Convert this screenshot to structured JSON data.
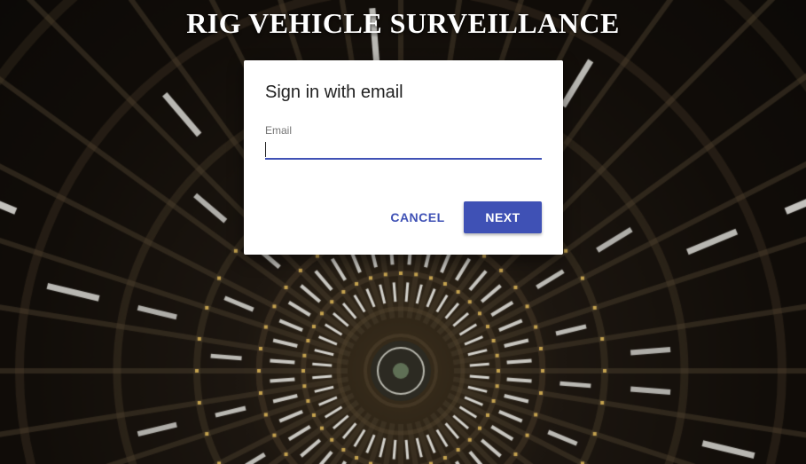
{
  "app": {
    "title": "RIG VEHICLE SURVEILLANCE"
  },
  "dialog": {
    "title": "Sign in with email",
    "email_label": "Email",
    "email_value": "",
    "cancel_label": "CANCEL",
    "next_label": "NEXT"
  },
  "colors": {
    "accent": "#3f51b5",
    "dialog_bg": "#ffffff",
    "title_text": "#ffffff"
  },
  "background": {
    "description_icon": "ceiling-lights-photo"
  }
}
